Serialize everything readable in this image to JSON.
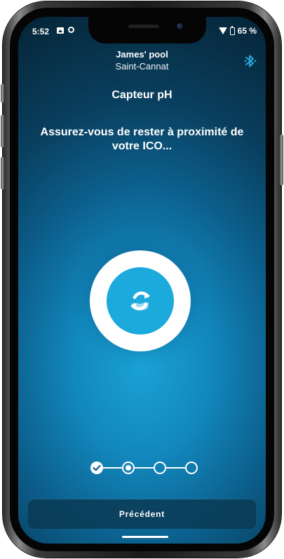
{
  "status_bar": {
    "time": "5:52",
    "battery": "65 %",
    "icons": [
      "image-icon",
      "sync-icon",
      "wifi-icon",
      "battery-icon"
    ]
  },
  "header": {
    "pool_name": "James' pool",
    "location": "Saint-Cannat",
    "bluetooth_icon": "bluetooth-icon"
  },
  "sensor": {
    "title": "Capteur pH"
  },
  "instruction": "Assurez-vous de rester à proximité de votre ICO...",
  "progress": {
    "icon": "refresh-icon",
    "steps_total": 4,
    "steps": [
      {
        "state": "done"
      },
      {
        "state": "current"
      },
      {
        "state": "pending"
      },
      {
        "state": "pending"
      }
    ]
  },
  "footer": {
    "previous_label": "Précédent"
  },
  "colors": {
    "accent": "#1ca9dc",
    "bluetooth": "#29a8e0",
    "text": "#ffffff"
  }
}
